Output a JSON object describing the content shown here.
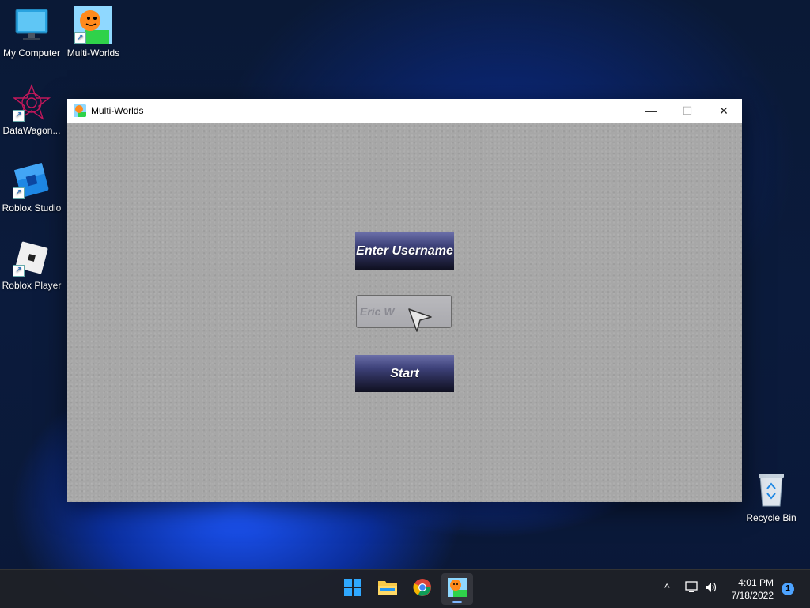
{
  "desktop": {
    "icons": [
      {
        "label": "My Computer",
        "icon": "monitor-icon"
      },
      {
        "label": "Multi-Worlds",
        "icon": "multi-worlds-icon"
      },
      {
        "label": "DataWagon...",
        "icon": "datawagon-icon"
      },
      {
        "label": "Roblox Studio",
        "icon": "roblox-studio-icon"
      },
      {
        "label": "Roblox Player",
        "icon": "roblox-player-icon"
      },
      {
        "label": "Recycle Bin",
        "icon": "recycle-bin-icon"
      }
    ]
  },
  "window": {
    "title": "Multi-Worlds",
    "minimize_symbol": "—",
    "maximize_symbol": "☐",
    "close_symbol": "✕",
    "enter_username_label": "Enter Username",
    "username_value": "Eric W",
    "start_label": "Start"
  },
  "taskbar": {
    "apps": [
      "start-menu-icon",
      "file-explorer-icon",
      "chrome-icon",
      "multi-worlds-icon"
    ],
    "tray": {
      "chevron": "^",
      "time": "4:01 PM",
      "date": "7/18/2022",
      "notification_count": "1"
    }
  },
  "colors": {
    "accent": "#4da3ff",
    "button_dark": "#2b2d55",
    "client_bg": "#a7a7a7"
  }
}
